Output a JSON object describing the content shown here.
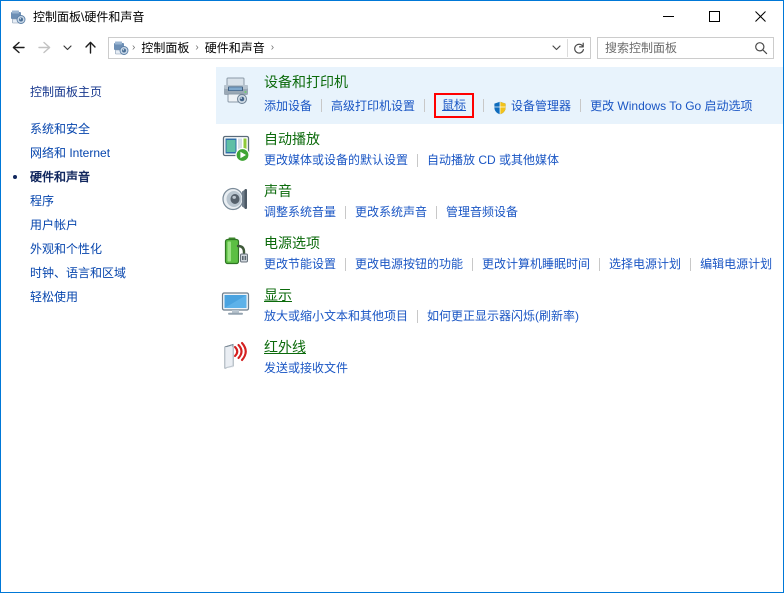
{
  "window": {
    "title": "控制面板\\硬件和声音",
    "icon": "hardware-and-sound-icon",
    "accent_color": "#0078d7",
    "caption": {
      "minimize": "—",
      "maximize": "☐",
      "close": "✕"
    }
  },
  "nav": {
    "back": "←",
    "forward": "→",
    "recent": "⌄",
    "up": "↑",
    "breadcrumb": [
      {
        "label": "控制面板"
      },
      {
        "label": "硬件和声音"
      }
    ],
    "breadcrumb_separator": "›",
    "history_dropdown": "⌄",
    "refresh": "↻"
  },
  "search": {
    "placeholder": "搜索控制面板",
    "value": "",
    "icon": "search-icon"
  },
  "sidebar": {
    "home": "控制面板主页",
    "items": [
      {
        "label": "系统和安全",
        "active": false
      },
      {
        "label": "网络和 Internet",
        "active": false
      },
      {
        "label": "硬件和声音",
        "active": true
      },
      {
        "label": "程序",
        "active": false
      },
      {
        "label": "用户帐户",
        "active": false
      },
      {
        "label": "外观和个性化",
        "active": false
      },
      {
        "label": "时钟、语言和区域",
        "active": false
      },
      {
        "label": "轻松使用",
        "active": false
      }
    ]
  },
  "categories": [
    {
      "title": "设备和打印机",
      "icon": "printer-icon",
      "hovered": true,
      "title_underlined": false,
      "links": [
        {
          "label": "添加设备",
          "shield": false,
          "annotated": false,
          "underlined": false
        },
        {
          "label": "高级打印机设置",
          "shield": false,
          "annotated": false,
          "underlined": false
        },
        {
          "label": "鼠标",
          "shield": false,
          "annotated": true,
          "underlined": true
        },
        {
          "label": "设备管理器",
          "shield": true,
          "annotated": false,
          "underlined": false
        },
        {
          "label": "更改 Windows To Go 启动选项",
          "shield": false,
          "annotated": false,
          "underlined": false
        }
      ]
    },
    {
      "title": "自动播放",
      "icon": "autoplay-icon",
      "hovered": false,
      "title_underlined": false,
      "links": [
        {
          "label": "更改媒体或设备的默认设置",
          "shield": false,
          "annotated": false,
          "underlined": false
        },
        {
          "label": "自动播放 CD 或其他媒体",
          "shield": false,
          "annotated": false,
          "underlined": false
        }
      ]
    },
    {
      "title": "声音",
      "icon": "speaker-icon",
      "hovered": false,
      "title_underlined": false,
      "links": [
        {
          "label": "调整系统音量",
          "shield": false,
          "annotated": false,
          "underlined": false
        },
        {
          "label": "更改系统声音",
          "shield": false,
          "annotated": false,
          "underlined": false
        },
        {
          "label": "管理音频设备",
          "shield": false,
          "annotated": false,
          "underlined": false
        }
      ]
    },
    {
      "title": "电源选项",
      "icon": "battery-icon",
      "hovered": false,
      "title_underlined": false,
      "links": [
        {
          "label": "更改节能设置",
          "shield": false,
          "annotated": false,
          "underlined": false
        },
        {
          "label": "更改电源按钮的功能",
          "shield": false,
          "annotated": false,
          "underlined": false
        },
        {
          "label": "更改计算机睡眠时间",
          "shield": false,
          "annotated": false,
          "underlined": false
        },
        {
          "label": "选择电源计划",
          "shield": false,
          "annotated": false,
          "underlined": false
        },
        {
          "label": "编辑电源计划",
          "shield": false,
          "annotated": false,
          "underlined": false
        }
      ]
    },
    {
      "title": "显示",
      "icon": "monitor-icon",
      "hovered": false,
      "title_underlined": true,
      "links": [
        {
          "label": "放大或缩小文本和其他项目",
          "shield": false,
          "annotated": false,
          "underlined": false
        },
        {
          "label": "如何更正显示器闪烁(刷新率)",
          "shield": false,
          "annotated": false,
          "underlined": false
        }
      ]
    },
    {
      "title": "红外线",
      "icon": "infrared-icon",
      "hovered": false,
      "title_underlined": true,
      "links": [
        {
          "label": "发送或接收文件",
          "shield": false,
          "annotated": false,
          "underlined": false
        }
      ]
    }
  ]
}
